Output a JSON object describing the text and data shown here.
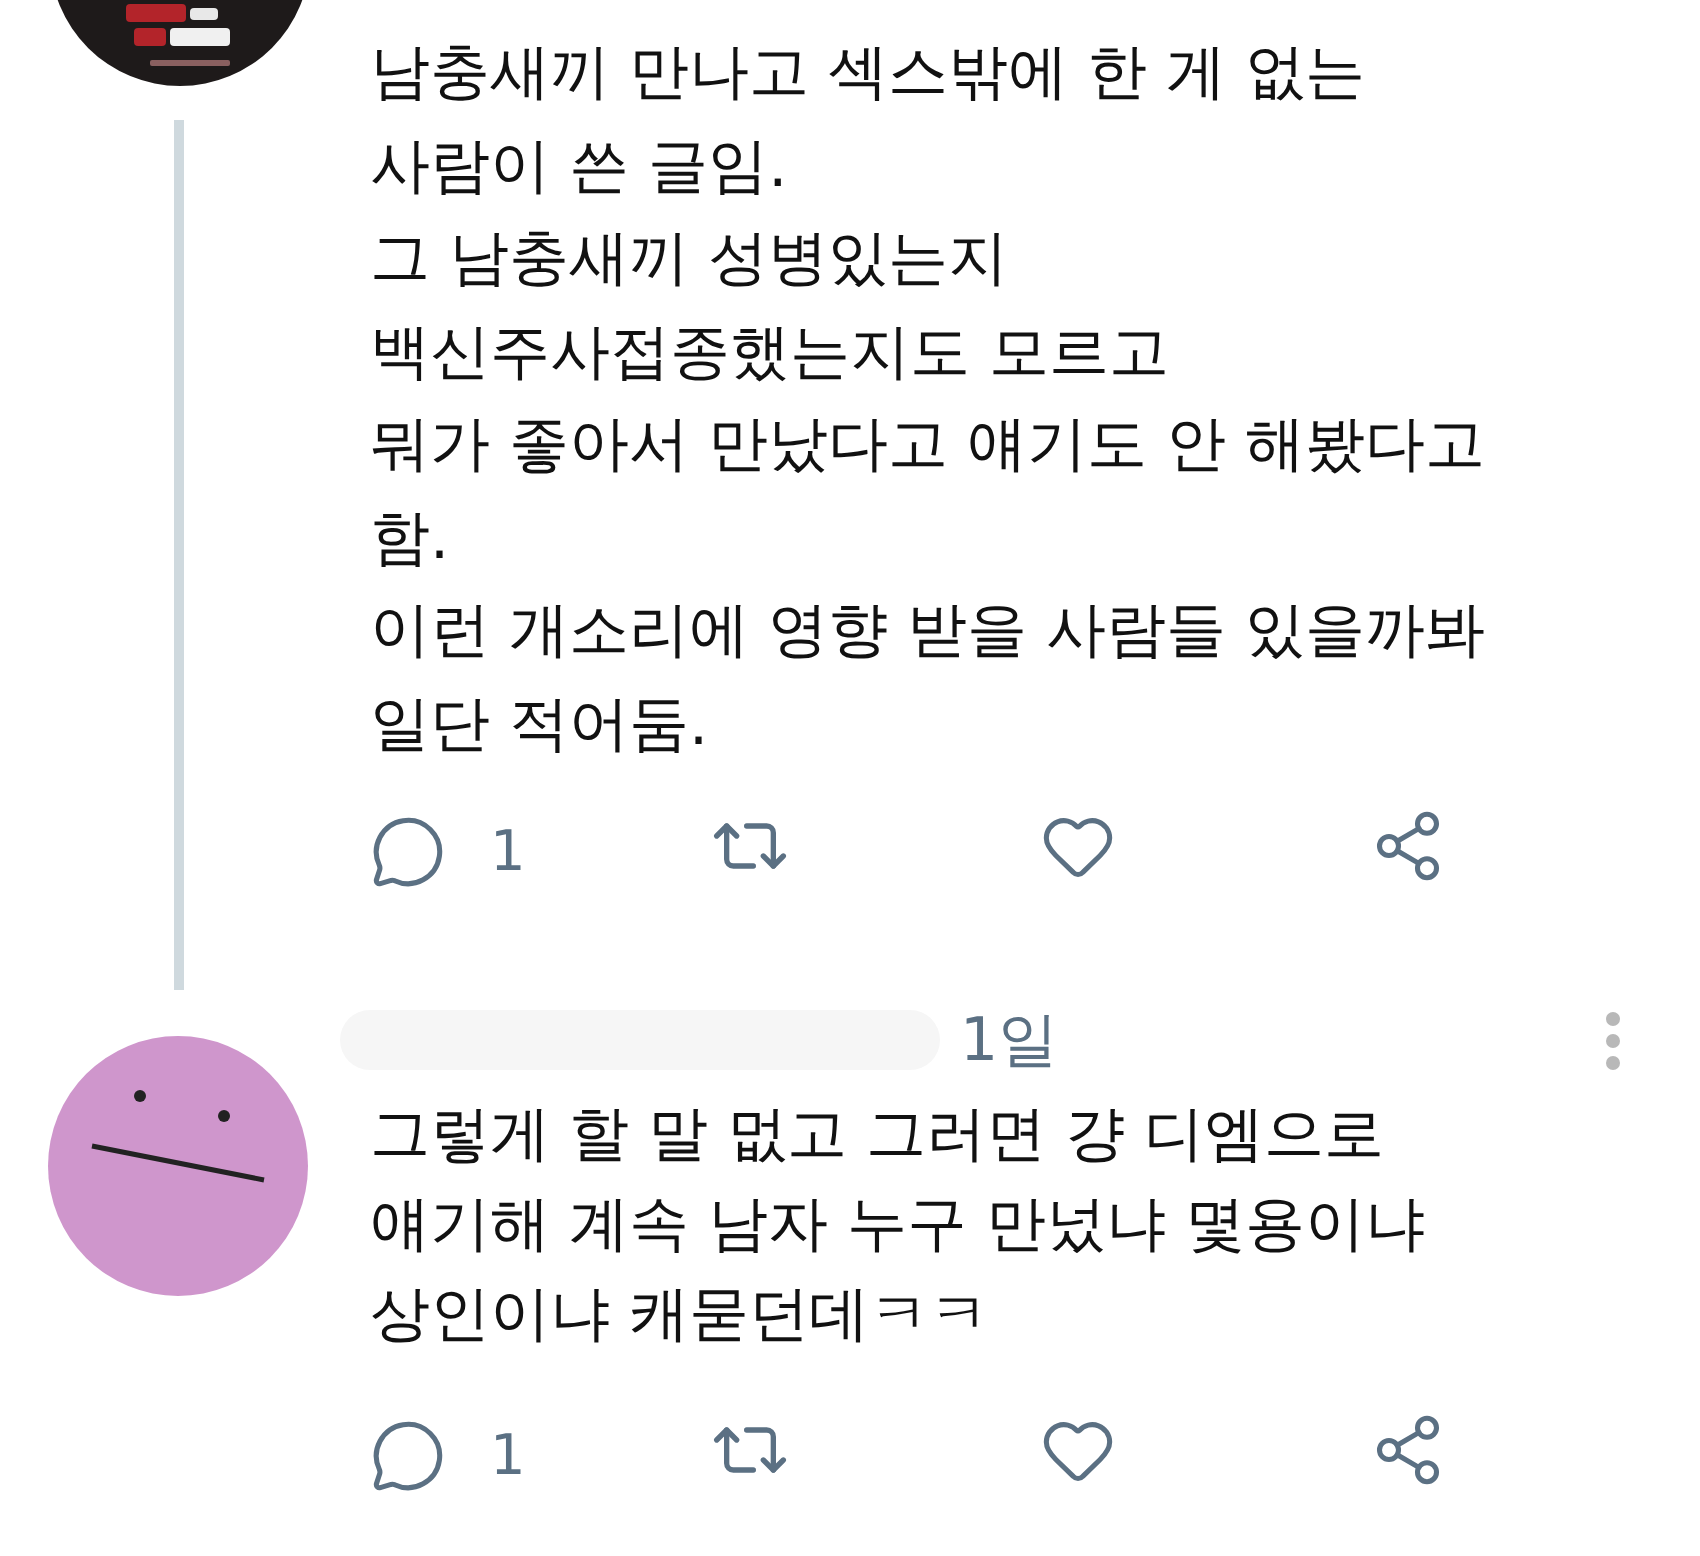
{
  "tweets": [
    {
      "text_lines": [
        "남충새끼 만나고 섹스밖에 한 게 없는",
        "사람이 쓴 글임.",
        "그 남충새끼 성병있는지",
        "백신주사접종했는지도 모르고",
        "뭐가 좋아서 만났다고 얘기도 안 해봤다고",
        "함.",
        "이런 개소리에 영향 받을 사람들 있을까봐",
        "일단 적어둠."
      ],
      "reply_count": "1"
    },
    {
      "avatar": {
        "kind": "drawing"
      },
      "time": "1일",
      "text_lines": [
        "그렇게 할 말 멊고 그러면 걍 디엠으로",
        "얘기해 계속 남자 누구 만넜냐 몇용이냐",
        "상인이냐 캐묻던데ㅋㅋ"
      ],
      "reply_count": "1"
    }
  ]
}
